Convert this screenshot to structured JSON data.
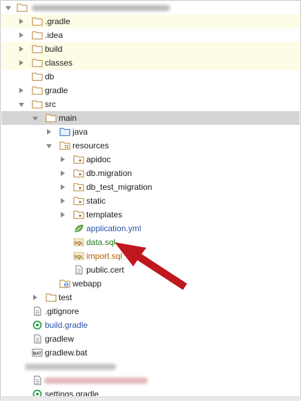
{
  "tree": {
    "items": [
      {
        "label": ".gradle",
        "icon": "folder-icon"
      },
      {
        "label": ".idea",
        "icon": "folder-icon"
      },
      {
        "label": "build",
        "icon": "folder-icon"
      },
      {
        "label": "classes",
        "icon": "folder-icon"
      },
      {
        "label": "db",
        "icon": "folder-icon"
      },
      {
        "label": "gradle",
        "icon": "folder-icon"
      },
      {
        "label": "src",
        "icon": "folder-icon"
      },
      {
        "label": "main",
        "icon": "folder-icon"
      },
      {
        "label": "java",
        "icon": "source-folder-icon"
      },
      {
        "label": "resources",
        "icon": "resources-folder-icon"
      },
      {
        "label": "apidoc",
        "icon": "package-folder-icon"
      },
      {
        "label": "db.migration",
        "icon": "package-folder-icon"
      },
      {
        "label": "db_test_migration",
        "icon": "package-folder-icon"
      },
      {
        "label": "static",
        "icon": "package-folder-icon"
      },
      {
        "label": "templates",
        "icon": "package-folder-icon"
      },
      {
        "label": "application.yml",
        "icon": "spring-leaf-icon"
      },
      {
        "label": "data.sql",
        "icon": "sql-file-icon"
      },
      {
        "label": "import.sql",
        "icon": "sql-file-icon"
      },
      {
        "label": "public.cert",
        "icon": "file-icon"
      },
      {
        "label": "webapp",
        "icon": "web-folder-icon"
      },
      {
        "label": "test",
        "icon": "folder-icon"
      },
      {
        "label": ".gitignore",
        "icon": "file-icon"
      },
      {
        "label": "build.gradle",
        "icon": "gradle-icon"
      },
      {
        "label": "gradlew",
        "icon": "file-icon"
      },
      {
        "label": "gradlew.bat",
        "icon": "bat-file-icon"
      },
      {
        "label": "settings.gradle",
        "icon": "gradle-icon"
      }
    ],
    "sql_badge": "SQL",
    "bat_badge": "BAT"
  },
  "colors": {
    "folder": "#c69a5c",
    "selection": "#d5d5d5",
    "excluded_bg": "#fdfce6",
    "arrow": "#c0171e",
    "link_blue": "#2a52a8",
    "git_green": "#1f7a1f",
    "git_orange": "#b25d00"
  }
}
